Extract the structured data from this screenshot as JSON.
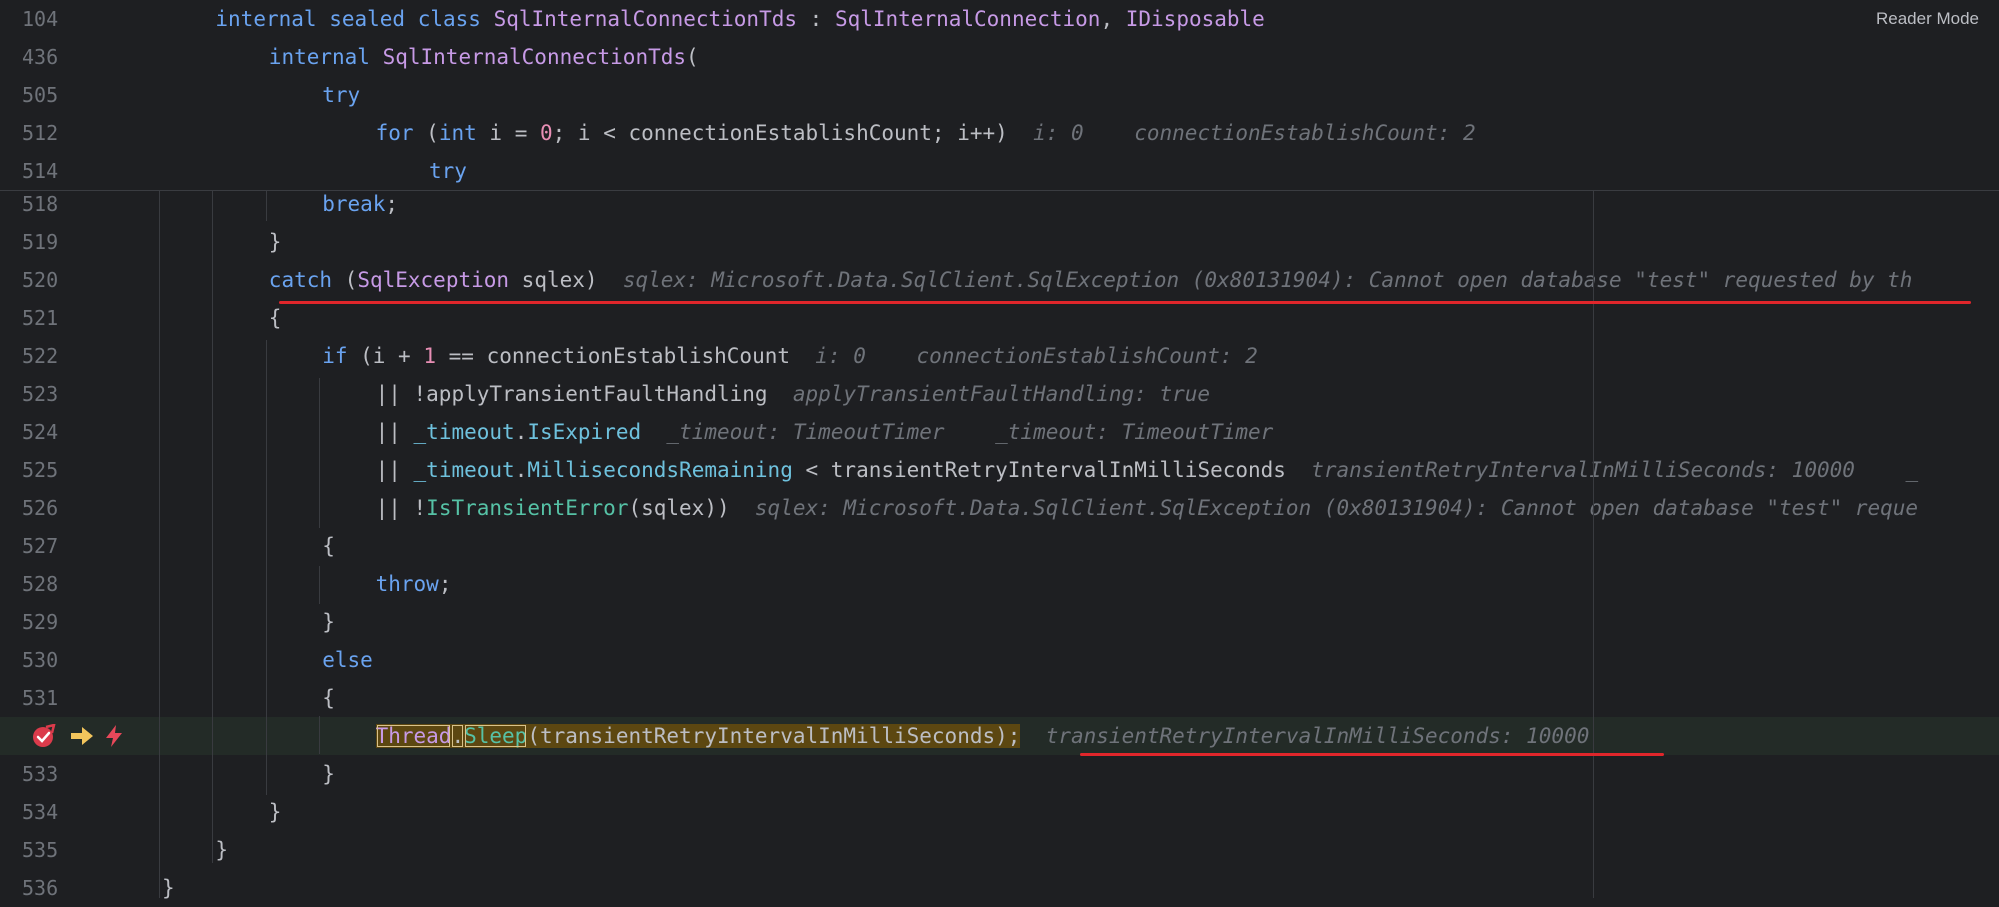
{
  "reader_mode_label": "Reader Mode",
  "sticky_lines": [
    {
      "number": "104",
      "indent": 4,
      "tokens": [
        {
          "t": "internal ",
          "c": "kw"
        },
        {
          "t": "sealed ",
          "c": "kw"
        },
        {
          "t": "class ",
          "c": "kw"
        },
        {
          "t": "SqlInternalConnectionTds",
          "c": "cls"
        },
        {
          "t": " : "
        },
        {
          "t": "SqlInternalConnection",
          "c": "cls"
        },
        {
          "t": ", "
        },
        {
          "t": "IDisposable",
          "c": "cls"
        }
      ]
    },
    {
      "number": "436",
      "indent": 8,
      "tokens": [
        {
          "t": "internal ",
          "c": "kw"
        },
        {
          "t": "SqlInternalConnectionTds",
          "c": "cls"
        },
        {
          "t": "("
        }
      ]
    },
    {
      "number": "505",
      "indent": 12,
      "tokens": [
        {
          "t": "try",
          "c": "kw"
        }
      ]
    },
    {
      "number": "512",
      "indent": 16,
      "tokens": [
        {
          "t": "for",
          "c": "kw"
        },
        {
          "t": " ("
        },
        {
          "t": "int",
          "c": "kw"
        },
        {
          "t": " i = "
        },
        {
          "t": "0",
          "c": "num"
        },
        {
          "t": "; i < connectionEstablishCount; i++)"
        },
        {
          "t": "  i: 0    connectionEstablishCount: 2",
          "c": "inlay"
        }
      ]
    },
    {
      "number": "514",
      "indent": 20,
      "tokens": [
        {
          "t": "try",
          "c": "kw"
        }
      ]
    }
  ],
  "lines": [
    {
      "number": "518",
      "indent": 12,
      "tokens": [
        {
          "t": "break",
          "c": "kw"
        },
        {
          "t": ";"
        }
      ]
    },
    {
      "number": "519",
      "indent": 8,
      "tokens": [
        {
          "t": "}"
        }
      ]
    },
    {
      "number": "520",
      "indent": 8,
      "tokens": [
        {
          "t": "catch",
          "c": "kw"
        },
        {
          "t": " ("
        },
        {
          "t": "SqlException",
          "c": "cls"
        },
        {
          "t": " sqlex)"
        },
        {
          "t": "  sqlex: Microsoft.Data.SqlClient.SqlException (0x80131904): Cannot open database \"test\" requested by th",
          "c": "inlay"
        }
      ]
    },
    {
      "number": "521",
      "indent": 8,
      "tokens": [
        {
          "t": "{"
        }
      ]
    },
    {
      "number": "522",
      "indent": 12,
      "tokens": [
        {
          "t": "if",
          "c": "kw"
        },
        {
          "t": " (i + "
        },
        {
          "t": "1",
          "c": "num"
        },
        {
          "t": " == connectionEstablishCount"
        },
        {
          "t": "  i: 0    connectionEstablishCount: 2",
          "c": "inlay"
        }
      ]
    },
    {
      "number": "523",
      "indent": 16,
      "tokens": [
        {
          "t": "|| !applyTransientFaultHandling"
        },
        {
          "t": "  applyTransientFaultHandling: true",
          "c": "inlay"
        }
      ]
    },
    {
      "number": "524",
      "indent": 16,
      "tokens": [
        {
          "t": "|| "
        },
        {
          "t": "_timeout",
          "c": "fld"
        },
        {
          "t": "."
        },
        {
          "t": "IsExpired",
          "c": "fld"
        },
        {
          "t": "  _timeout: TimeoutTimer    _timeout: TimeoutTimer",
          "c": "inlay"
        }
      ]
    },
    {
      "number": "525",
      "indent": 16,
      "tokens": [
        {
          "t": "|| "
        },
        {
          "t": "_timeout",
          "c": "fld"
        },
        {
          "t": "."
        },
        {
          "t": "MillisecondsRemaining",
          "c": "fld"
        },
        {
          "t": " < transientRetryIntervalInMilliSeconds"
        },
        {
          "t": "  transientRetryIntervalInMilliSeconds: 10000    _",
          "c": "inlay"
        }
      ]
    },
    {
      "number": "526",
      "indent": 16,
      "tokens": [
        {
          "t": "|| !"
        },
        {
          "t": "IsTransientError",
          "c": "fn"
        },
        {
          "t": "(sqlex))"
        },
        {
          "t": "  sqlex: Microsoft.Data.SqlClient.SqlException (0x80131904): Cannot open database \"test\" reque",
          "c": "inlay"
        }
      ]
    },
    {
      "number": "527",
      "indent": 12,
      "tokens": [
        {
          "t": "{"
        }
      ]
    },
    {
      "number": "528",
      "indent": 16,
      "tokens": [
        {
          "t": "throw",
          "c": "kw"
        },
        {
          "t": ";"
        }
      ]
    },
    {
      "number": "529",
      "indent": 12,
      "tokens": [
        {
          "t": "}"
        }
      ]
    },
    {
      "number": "530",
      "indent": 12,
      "tokens": [
        {
          "t": "else",
          "c": "kw"
        }
      ]
    },
    {
      "number": "531",
      "indent": 12,
      "tokens": [
        {
          "t": "{"
        }
      ]
    },
    {
      "number": "",
      "indent": 16,
      "current": true,
      "tokens": [
        {
          "t": "Thread",
          "c": "cls exec box"
        },
        {
          "t": ".",
          "c": "exec box"
        },
        {
          "t": "Sleep",
          "c": "fn exec box"
        },
        {
          "t": "(transientRetryIntervalInMilliSeconds);",
          "c": "exec"
        },
        {
          "t": "  transientRetryIntervalInMilliSeconds: 10000",
          "c": "inlay"
        }
      ]
    },
    {
      "number": "533",
      "indent": 12,
      "tokens": [
        {
          "t": "}"
        }
      ]
    },
    {
      "number": "534",
      "indent": 8,
      "tokens": [
        {
          "t": "}"
        }
      ]
    },
    {
      "number": "535",
      "indent": 4,
      "tokens": [
        {
          "t": "}"
        }
      ]
    },
    {
      "number": "536",
      "indent": 0,
      "tokens": [
        {
          "t": "}"
        }
      ]
    }
  ],
  "gutter_icons": {
    "breakpoint": "breakpoint-icon",
    "execution_point": "execution-arrow-icon",
    "hot_swap": "lightning-icon"
  },
  "colors": {
    "background": "#1e1f22",
    "keyword": "#6aa3f0",
    "class": "#c79ae6",
    "number": "#e88fb5",
    "method": "#56c2a6",
    "field": "#6ec1dd",
    "inlay_hint": "#6f737a",
    "exec_highlight": "#5c4711",
    "annotation_underline": "#e0262b"
  }
}
